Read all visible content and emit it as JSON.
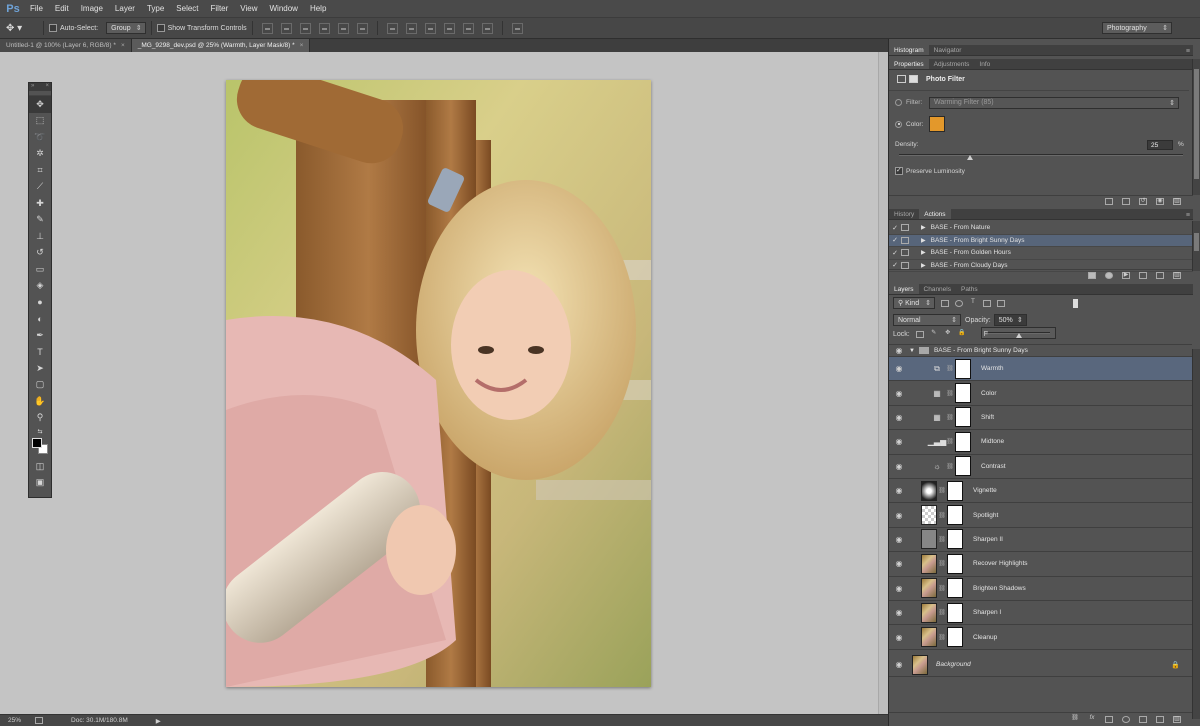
{
  "app": {
    "logo": "Ps",
    "menu": [
      "File",
      "Edit",
      "Image",
      "Layer",
      "Type",
      "Select",
      "Filter",
      "View",
      "Window",
      "Help"
    ]
  },
  "options": {
    "auto_select_label": "Auto-Select:",
    "auto_select_value": "Group",
    "transform_label": "Show Transform Controls",
    "workspace": "Photography"
  },
  "tabs": [
    {
      "label": "Untitled-1 @ 100% (Layer 6, RGB/8) *",
      "close": "×"
    },
    {
      "label": "_MG_9298_dev.psd @ 25% (Warmth, Layer Mask/8) *",
      "close": "×"
    }
  ],
  "status": {
    "zoom": "25%",
    "doc": "Doc: 30.1M/180.8M",
    "arrow": "▶"
  },
  "panels": {
    "top_tabs": [
      "Histogram",
      "Navigator"
    ],
    "props_tabs": [
      "Properties",
      "Adjustments",
      "Info"
    ],
    "properties": {
      "title": "Photo Filter",
      "filter_label": "Filter:",
      "filter_value": "Warming Filter (85)",
      "color_label": "Color:",
      "color": "#E3982B",
      "density_label": "Density:",
      "density_value": 25,
      "density_unit": "%",
      "preserve_label": "Preserve Luminosity"
    },
    "actions_tabs": [
      "History",
      "Actions"
    ],
    "actions": [
      {
        "name": "BASE - From Nature",
        "selected": false
      },
      {
        "name": "BASE - From Bright Sunny Days",
        "selected": true
      },
      {
        "name": "BASE - From Golden Hours",
        "selected": false
      },
      {
        "name": "BASE - From Cloudy Days",
        "selected": false
      }
    ],
    "layers_tabs": [
      "Layers",
      "Channels",
      "Paths"
    ],
    "layers_controls": {
      "kind_value": "Kind",
      "blend_mode": "Normal",
      "opacity_label": "Opacity:",
      "opacity_value": "50%",
      "lock_label": "Lock:",
      "fill_label": "F"
    },
    "group_name": "BASE - From Bright Sunny Days",
    "layers": [
      {
        "name": "Warmth",
        "icon": "photo-filter-icon",
        "selected": true
      },
      {
        "name": "Color",
        "icon": "hue-saturation-icon",
        "selected": false
      },
      {
        "name": "Shift",
        "icon": "hue-saturation-icon",
        "selected": false
      },
      {
        "name": "Midtone",
        "icon": "levels-icon",
        "selected": false
      },
      {
        "name": "Contrast",
        "icon": "brightness-icon",
        "selected": false
      },
      {
        "name": "Vignette",
        "icon": "vignette-thumbnail",
        "selected": false
      },
      {
        "name": "Spotlight",
        "icon": "spotlight-thumbnail",
        "selected": false
      },
      {
        "name": "Sharpen II",
        "icon": "gray-thumbnail",
        "selected": false
      },
      {
        "name": "Recover Highlights",
        "icon": "image-thumbnail",
        "selected": false
      },
      {
        "name": "Brighten Shadows",
        "icon": "image-thumbnail",
        "selected": false
      },
      {
        "name": "Sharpen I",
        "icon": "image-thumbnail",
        "selected": false
      },
      {
        "name": "Cleanup",
        "icon": "image-thumbnail",
        "selected": false
      }
    ],
    "background_layer": "Background"
  }
}
